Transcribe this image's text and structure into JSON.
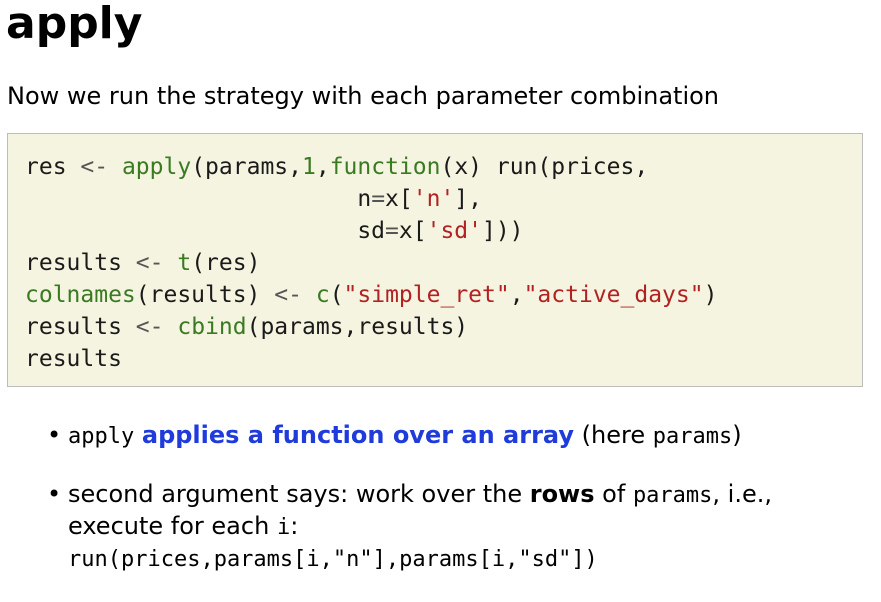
{
  "title": "apply",
  "intro": "Now we run the strategy with each parameter combination",
  "code": {
    "line1": {
      "a": "res ",
      "b": "<-",
      "c": " ",
      "d": "apply",
      "e": "(params,",
      "f": "1",
      "g": ",",
      "h": "function",
      "i": "(x) run(prices,"
    },
    "line2": {
      "a": "                        n",
      "b": "=",
      "c": "x[",
      "d": "'n'",
      "e": "],"
    },
    "line3": {
      "a": "                        sd",
      "b": "=",
      "c": "x[",
      "d": "'sd'",
      "e": "]))"
    },
    "line4": {
      "a": "results ",
      "b": "<-",
      "c": " ",
      "d": "t",
      "e": "(res)"
    },
    "line5": {
      "a": "colnames",
      "b": "(results) ",
      "c": "<-",
      "d": " ",
      "e": "c",
      "f": "(",
      "g": "\"simple_ret\"",
      "h": ",",
      "i": "\"active_days\"",
      "j": ")"
    },
    "line6": {
      "a": "results ",
      "b": "<-",
      "c": " ",
      "d": "cbind",
      "e": "(params,results)"
    },
    "line7": "results"
  },
  "bullets": {
    "b1": {
      "code1": "apply",
      "link": "applies a function over an array",
      "text1": "(here",
      "code2": "params",
      "text2": ")"
    },
    "b2": {
      "text1": "second argument says: work over the",
      "strong": "rows",
      "text2": "of",
      "code1": "params",
      "text3": ", i.e., execute for each",
      "code2": "i",
      "text4": ":",
      "code3": "run(prices,params[i,\"n\"],params[i,\"sd\"])"
    }
  }
}
